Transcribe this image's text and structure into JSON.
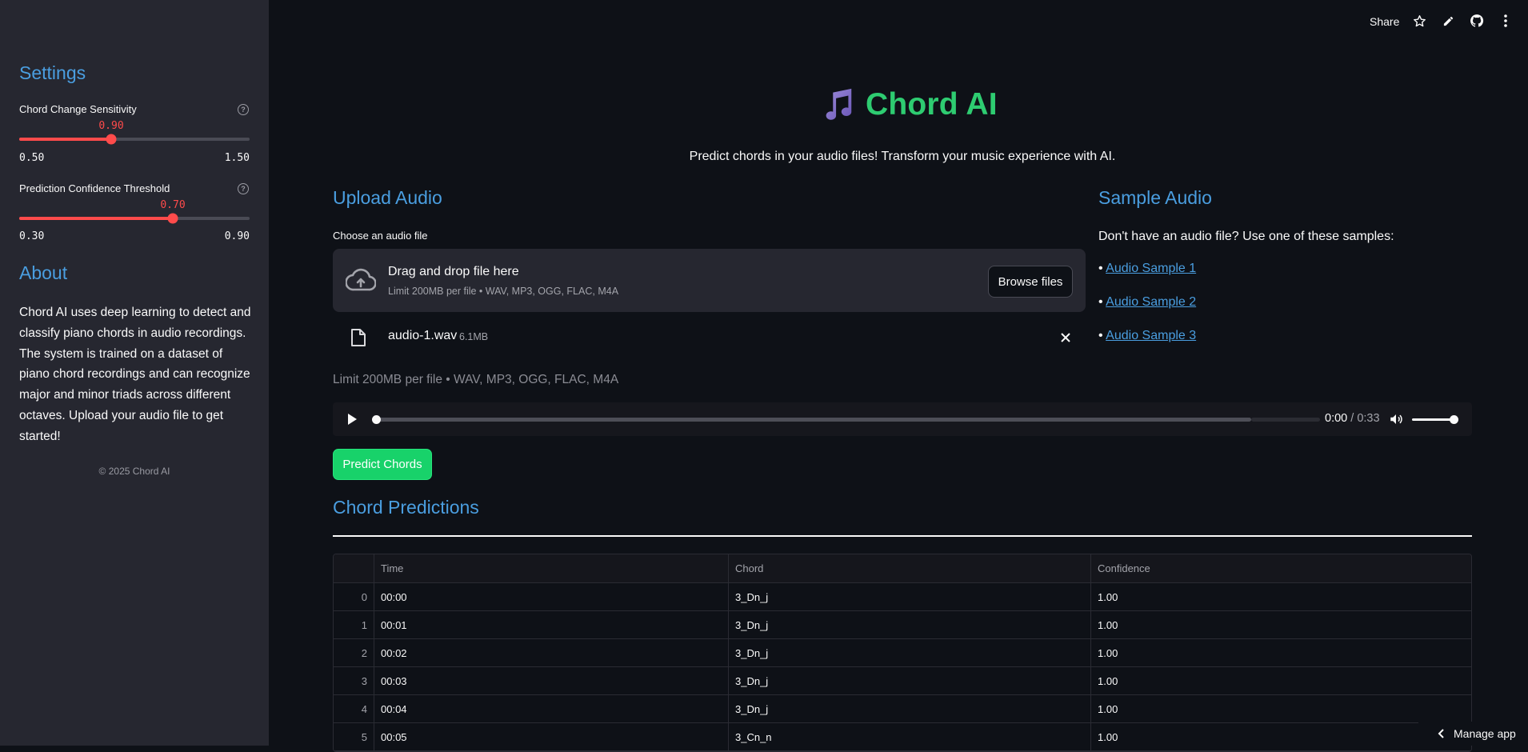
{
  "sidebar": {
    "settings_heading": "Settings",
    "sliders": [
      {
        "label": "Chord Change Sensitivity",
        "value": "0.90",
        "min": "0.50",
        "max": "1.50",
        "fraction": 0.4
      },
      {
        "label": "Prediction Confidence Threshold",
        "value": "0.70",
        "min": "0.30",
        "max": "0.90",
        "fraction": 0.6667
      }
    ],
    "about_heading": "About",
    "about_text": "Chord AI uses deep learning to detect and classify piano chords in audio recordings. The system is trained on a dataset of piano chord recordings and can recognize major and minor triads across different octaves. Upload your audio file to get started!",
    "copyright": "© 2025 Chord AI"
  },
  "toolbar": {
    "share_label": "Share",
    "icons": [
      "star-icon",
      "edit-icon",
      "github-icon",
      "more-icon"
    ]
  },
  "header": {
    "title": "Chord AI",
    "icon": "music-note-icon",
    "tagline": "Predict chords in your audio files! Transform your music experience with AI."
  },
  "upload": {
    "heading": "Upload Audio",
    "label": "Choose an audio file",
    "drop_title": "Drag and drop file here",
    "drop_sub": "Limit 200MB per file • WAV, MP3, OGG, FLAC, M4A",
    "browse_label": "Browse files",
    "file_name": "audio-1.wav",
    "file_size": "6.1MB",
    "limit_text": "Limit 200MB per file • WAV, MP3, OGG, FLAC, M4A"
  },
  "player": {
    "current": "0:00",
    "separator": " / ",
    "duration": "0:33",
    "progress_fraction": 0.0,
    "volume_fraction": 1.0
  },
  "predict_label": "Predict Chords",
  "samples": {
    "heading": "Sample Audio",
    "intro": "Don't have an audio file? Use one of these samples:",
    "bullet": "• ",
    "items": [
      "Audio Sample 1",
      "Audio Sample 2",
      "Audio Sample 3"
    ]
  },
  "predictions": {
    "heading": "Chord Predictions",
    "columns": [
      "",
      "Time",
      "Chord",
      "Confidence"
    ],
    "rows": [
      [
        "0",
        "00:00",
        "3_Dn_j",
        "1.00"
      ],
      [
        "1",
        "00:01",
        "3_Dn_j",
        "1.00"
      ],
      [
        "2",
        "00:02",
        "3_Dn_j",
        "1.00"
      ],
      [
        "3",
        "00:03",
        "3_Dn_j",
        "1.00"
      ],
      [
        "4",
        "00:04",
        "3_Dn_j",
        "1.00"
      ],
      [
        "5",
        "00:05",
        "3_Cn_n",
        "1.00"
      ]
    ]
  },
  "manage_app_label": "Manage app",
  "colors": {
    "accent_blue": "#4a9ee0",
    "accent_green": "#2ecc71",
    "slider_red": "#ff4b4b",
    "background": "#0e1117",
    "sidebar_bg": "#262730"
  }
}
